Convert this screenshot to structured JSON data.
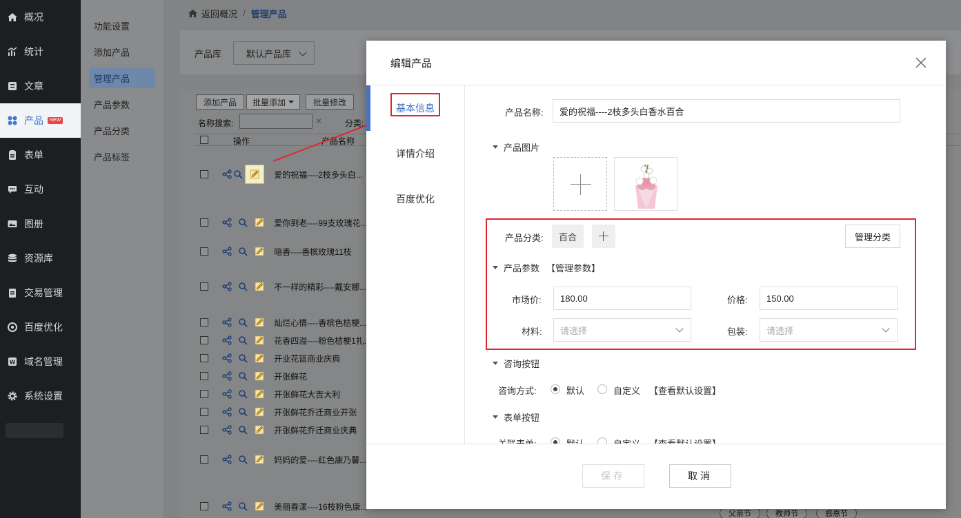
{
  "sidebar": {
    "items": [
      {
        "label": "概况",
        "icon": "home-icon"
      },
      {
        "label": "统计",
        "icon": "chart-icon"
      },
      {
        "label": "文章",
        "icon": "article-icon"
      },
      {
        "label": "产品",
        "icon": "grid-icon",
        "badge": "NEW"
      },
      {
        "label": "表单",
        "icon": "clipboard-icon"
      },
      {
        "label": "互动",
        "icon": "chat-icon"
      },
      {
        "label": "图册",
        "icon": "image-icon"
      },
      {
        "label": "资源库",
        "icon": "database-icon"
      },
      {
        "label": "交易管理",
        "icon": "wallet-icon"
      },
      {
        "label": "百度优化",
        "icon": "target-icon"
      },
      {
        "label": "域名管理",
        "icon": "domain-icon"
      },
      {
        "label": "系统设置",
        "icon": "gear-icon"
      }
    ]
  },
  "subnav": {
    "items": [
      "功能设置",
      "添加产品",
      "管理产品",
      "产品参数",
      "产品分类",
      "产品标签"
    ]
  },
  "breadcrumb": {
    "back": "返回概况",
    "sep": "/",
    "current": "管理产品"
  },
  "library": {
    "label": "产品库",
    "value": "默认产品库"
  },
  "table_toolbar": {
    "add": "添加产品",
    "batch_add": "批量添加",
    "batch_edit": "批量修改"
  },
  "search": {
    "label": "名称搜索:",
    "clear": "×",
    "category_label": "分类:"
  },
  "table": {
    "col_ops": "操作",
    "col_name": "产品名称",
    "rows": [
      "爱的祝福----2枝多头白...",
      "爱你到老----99支玫瑰花...",
      "暗香----香槟玫瑰11枝",
      "不一样的精彩----戴安娜...",
      "灿烂心情----香槟色桔梗...",
      "花香四溢----粉色桔梗1扎...",
      "开业花篮商业庆典",
      "开张鲜花",
      "开张鲜花大吉大利",
      "开张鲜花乔迁商业开张",
      "开张鲜花乔迁商业庆典",
      "妈妈的爱----红色康乃馨...",
      "美丽春漾----16枝粉色康..."
    ]
  },
  "bottom_tags": [
    "父亲节",
    "教师节",
    "感恩节"
  ],
  "modal": {
    "title": "编辑产品",
    "tabs": [
      "基本信息",
      "详情介绍",
      "百度优化"
    ],
    "name_label": "产品名称:",
    "name_value": "爱的祝福----2枝多头白香水百合",
    "image_section": "产品图片",
    "category_label": "产品分类:",
    "category_tag": "百合",
    "manage_category": "管理分类",
    "params_section": "产品参数",
    "manage_params": "【管理参数】",
    "market_price_label": "市场价:",
    "market_price": "180.00",
    "price_label": "价格:",
    "price": "150.00",
    "material_label": "材料:",
    "material_placeholder": "请选择",
    "package_label": "包装:",
    "package_placeholder": "请选择",
    "consult_section": "咨询按钮",
    "consult_label": "咨询方式:",
    "opt_default": "默认",
    "opt_custom": "自定义",
    "view_default": "【查看默认设置】",
    "form_section": "表单按钮",
    "form_label": "关联表单:",
    "save": "保存",
    "cancel": "取消"
  },
  "colors": {
    "accent": "#3a6fc0",
    "highlight_red": "#e0262f",
    "sidebar_bg": "#1c1e22"
  }
}
